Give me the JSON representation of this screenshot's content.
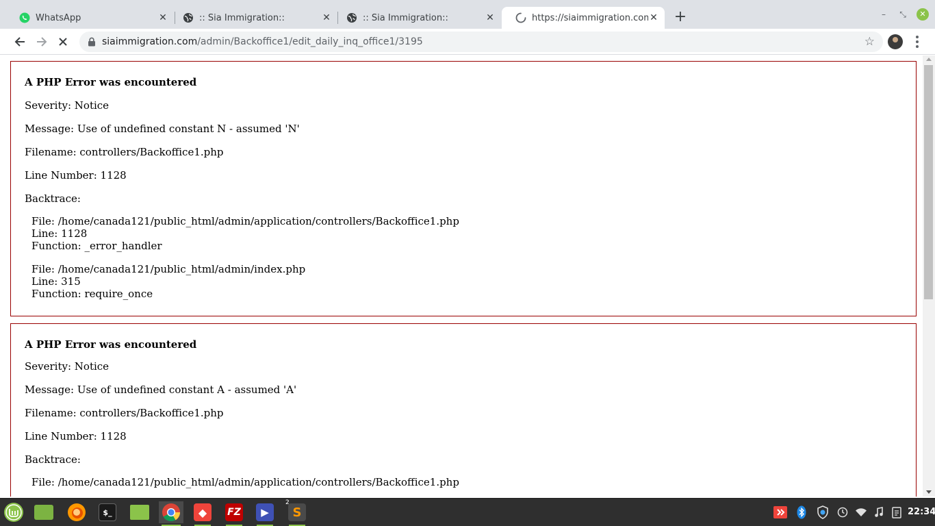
{
  "tabs": [
    {
      "title": "WhatsApp",
      "icon": "whatsapp-icon"
    },
    {
      "title": ":: Sia Immigration::",
      "icon": "globe-icon"
    },
    {
      "title": ":: Sia Immigration::",
      "icon": "globe-icon"
    },
    {
      "title": "https://siaimmigration.com/admin",
      "icon": "loading-spinner-icon",
      "active": true
    }
  ],
  "address": {
    "host": "siaimmigration.com",
    "path": "/admin/Backoffice1/edit_daily_inq_office1/3195"
  },
  "errors": [
    {
      "heading": "A PHP Error was encountered",
      "severity": "Severity: Notice",
      "message": "Message: Use of undefined constant N - assumed 'N'",
      "filename": "Filename: controllers/Backoffice1.php",
      "line_number": "Line Number: 1128",
      "backtrace_label": "Backtrace:",
      "backtrace": [
        {
          "file": "File: /home/canada121/public_html/admin/application/controllers/Backoffice1.php",
          "line": "Line: 1128",
          "function": "Function: _error_handler"
        },
        {
          "file": "File: /home/canada121/public_html/admin/index.php",
          "line": "Line: 315",
          "function": "Function: require_once"
        }
      ]
    },
    {
      "heading": "A PHP Error was encountered",
      "severity": "Severity: Notice",
      "message": "Message: Use of undefined constant A - assumed 'A'",
      "filename": "Filename: controllers/Backoffice1.php",
      "line_number": "Line Number: 1128",
      "backtrace_label": "Backtrace:",
      "backtrace": [
        {
          "file": "File: /home/canada121/public_html/admin/application/controllers/Backoffice1.php"
        }
      ]
    }
  ],
  "taskbar": {
    "apps": [
      "mint-menu-icon",
      "files-icon",
      "firefox-icon",
      "terminal-icon",
      "folder-icon",
      "chrome-icon",
      "anydesk-icon",
      "filezilla-icon",
      "media-player-icon",
      "sublime-text-icon"
    ],
    "sublime_badge": "2",
    "clock": "22:34"
  },
  "colors": {
    "error_border": "#990000",
    "tab_strip": "#dee1e6",
    "taskbar": "#2f2f2f"
  }
}
